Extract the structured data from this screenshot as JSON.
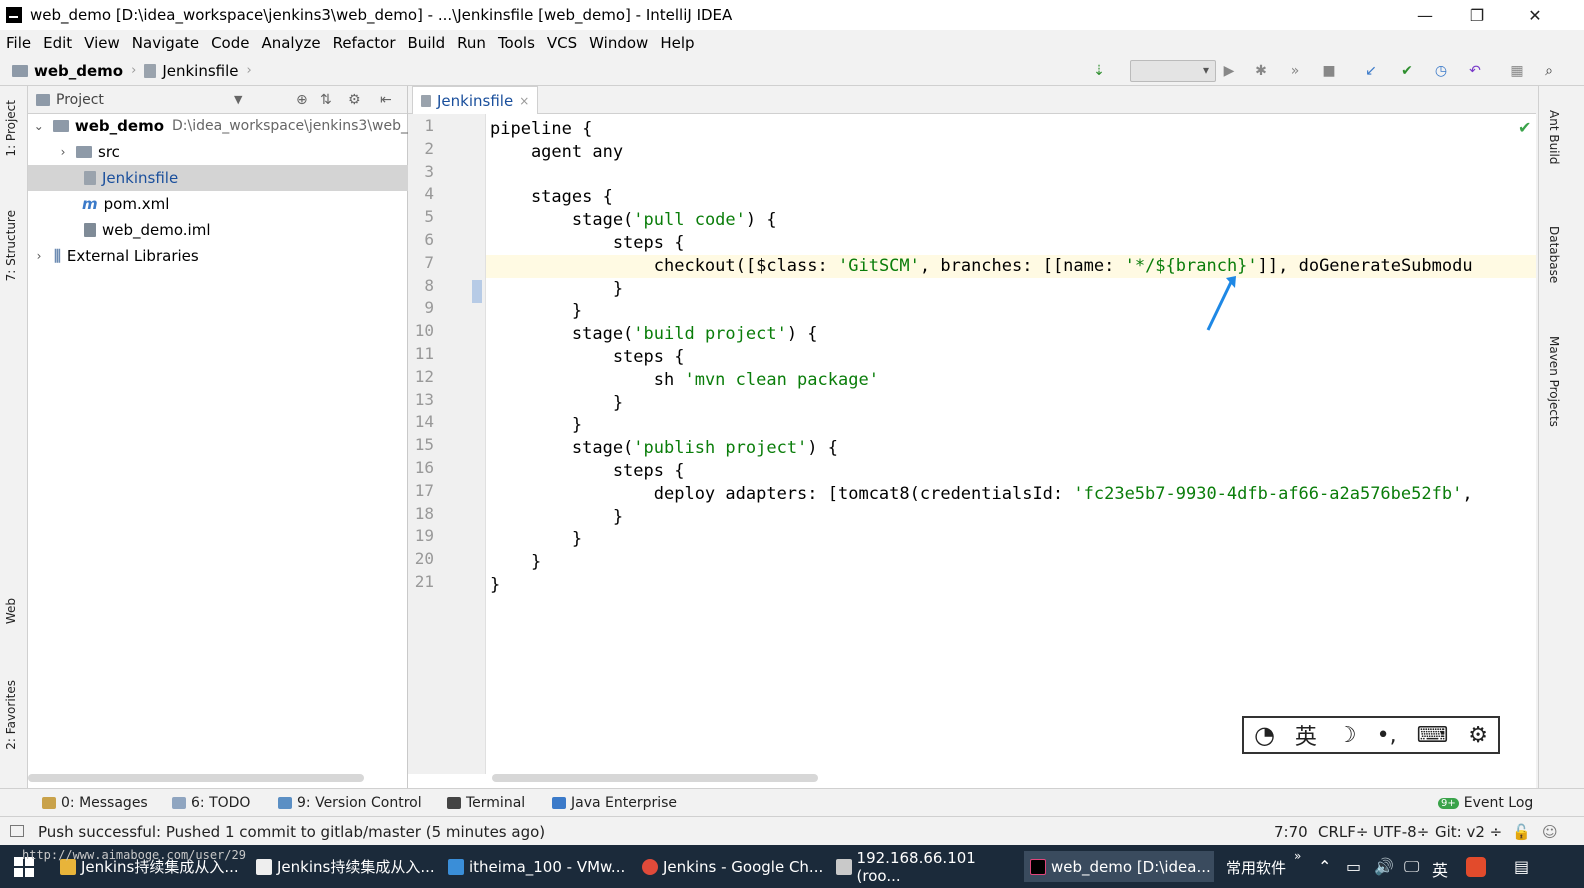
{
  "window": {
    "title": "web_demo [D:\\idea_workspace\\jenkins3\\web_demo] - ...\\Jenkinsfile [web_demo] - IntelliJ IDEA",
    "minimize": "—",
    "maximize": "❐",
    "close": "✕"
  },
  "menu": [
    "File",
    "Edit",
    "View",
    "Navigate",
    "Code",
    "Analyze",
    "Refactor",
    "Build",
    "Run",
    "Tools",
    "VCS",
    "Window",
    "Help"
  ],
  "breadcrumb": {
    "project": "web_demo",
    "file": "Jenkinsfile"
  },
  "side_tabs_left": {
    "project": "1: Project",
    "structure": "7: Structure",
    "web": "Web",
    "favorites": "2: Favorites"
  },
  "side_tabs_right": {
    "ant": "Ant Build",
    "database": "Database",
    "maven": "Maven Projects"
  },
  "project_panel": {
    "header": "Project",
    "tree": [
      {
        "label": "web_demo",
        "path": "D:\\idea_workspace\\jenkins3\\web_"
      },
      {
        "label": "src"
      },
      {
        "label": "Jenkinsfile"
      },
      {
        "label": "pom.xml"
      },
      {
        "label": "web_demo.iml"
      },
      {
        "label": "External Libraries"
      }
    ]
  },
  "editor": {
    "tab": "Jenkinsfile",
    "tab_close": "×",
    "current_line": 7,
    "line_numbers": [
      "1",
      "2",
      "3",
      "4",
      "5",
      "6",
      "7",
      "8",
      "9",
      "10",
      "11",
      "12",
      "13",
      "14",
      "15",
      "16",
      "17",
      "18",
      "19",
      "20",
      "21"
    ],
    "lines": [
      "pipeline {",
      "    agent any",
      "",
      "    stages {",
      "        stage('pull code') {",
      "            steps {",
      "                checkout([$class: 'GitSCM', branches: [[name: '*/${branch}']], doGenerateSubmodu",
      "            }",
      "        }",
      "        stage('build project') {",
      "            steps {",
      "                sh 'mvn clean package'",
      "            }",
      "        }",
      "        stage('publish project') {",
      "            steps {",
      "                deploy adapters: [tomcat8(credentialsId: 'fc23e5b7-9930-4dfb-af66-a2a576be52fb',",
      "            }",
      "        }",
      "    }",
      "}"
    ]
  },
  "ime_bar": [
    "英",
    "☽",
    "•,",
    "⌨",
    "⚙"
  ],
  "tool_windows": {
    "messages": "0: Messages",
    "todo": "6: TODO",
    "vcs": "9: Version Control",
    "terminal": "Terminal",
    "java_enterprise": "Java Enterprise",
    "event_log": "Event Log",
    "event_badge": "9+"
  },
  "status": {
    "message": "Push successful: Pushed 1 commit to gitlab/master (5 minutes ago)",
    "position": "7:70",
    "line_sep": "CRLF÷",
    "encoding": "UTF-8÷",
    "vcs": "Git: v2 ÷"
  },
  "taskbar": {
    "watermark": "http://www.aimaboge.com/user/29",
    "items": [
      {
        "label": "Jenkins持续集成从入..."
      },
      {
        "label": "Jenkins持续集成从入..."
      },
      {
        "label": "itheima_100 - VMw..."
      },
      {
        "label": "Jenkins - Google Ch..."
      },
      {
        "label": "192.168.66.101 (roo..."
      },
      {
        "label": "web_demo [D:\\idea..."
      }
    ],
    "tray_label": "常用软件",
    "lang": "英"
  },
  "colors": {
    "selected_row": "#d4d4d4",
    "tab_text": "#1a4f9c",
    "string": "#0a7d0a",
    "current_line": "#fffae3",
    "annotation_arrow": "#1e88e5"
  }
}
